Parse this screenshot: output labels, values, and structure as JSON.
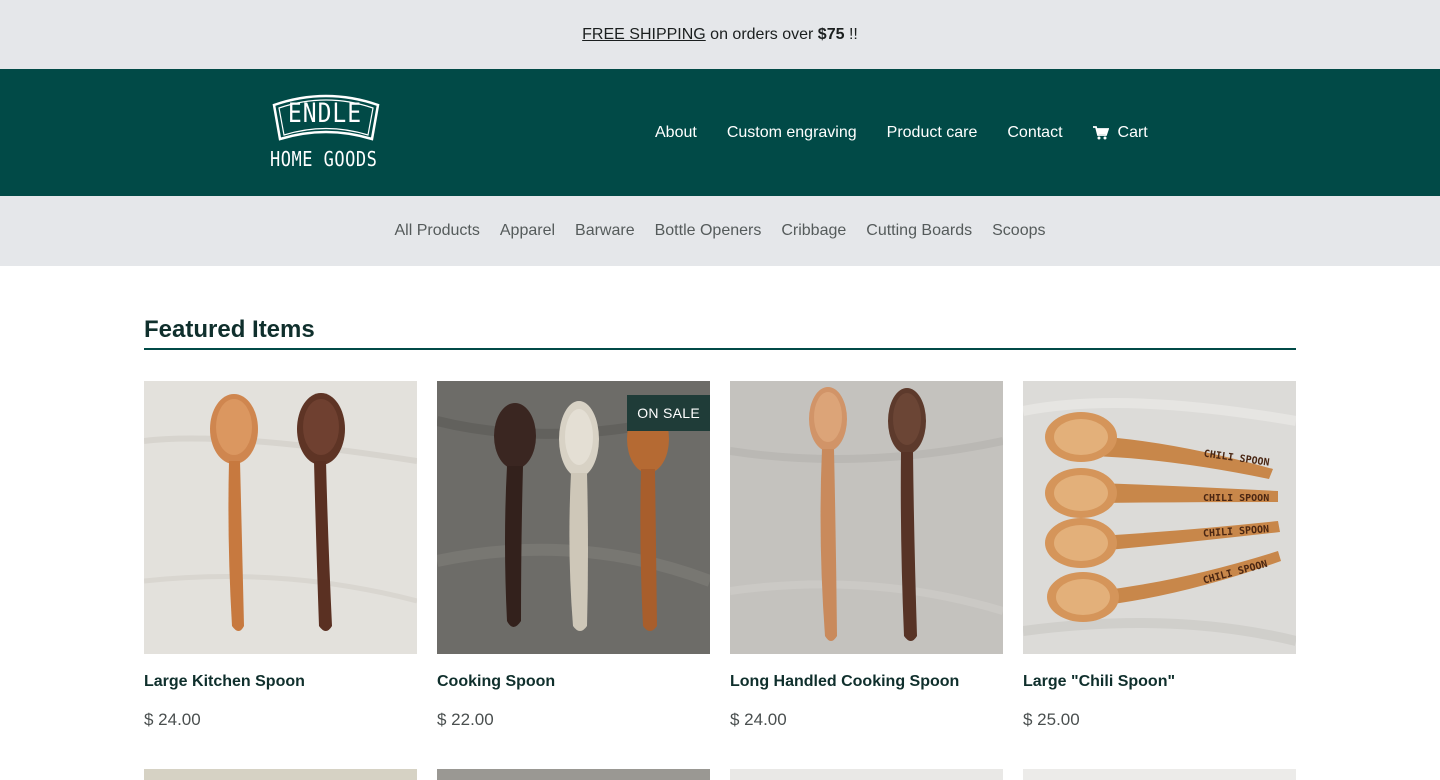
{
  "announcement": {
    "link_text": "FREE SHIPPING",
    "middle_text": " on orders over ",
    "amount": "$75",
    "suffix": " !!"
  },
  "brand": {
    "name": "ENDLE",
    "sub": "HOME GOODS"
  },
  "main_nav": {
    "items": [
      "About",
      "Custom engraving",
      "Product care",
      "Contact"
    ],
    "cart_label": "Cart",
    "cart_icon": "cart-icon"
  },
  "categories": [
    "All Products",
    "Apparel",
    "Barware",
    "Bottle Openers",
    "Cribbage",
    "Cutting Boards",
    "Scoops"
  ],
  "featured": {
    "title": "Featured Items",
    "products": [
      {
        "name": "Large Kitchen Spoon",
        "price": "$ 24.00",
        "badge": ""
      },
      {
        "name": "Cooking Spoon",
        "price": "$ 22.00",
        "badge": "ON SALE"
      },
      {
        "name": "Long Handled Cooking Spoon",
        "price": "$ 24.00",
        "badge": ""
      },
      {
        "name": "Large \"Chili Spoon\"",
        "price": "$ 25.00",
        "badge": ""
      }
    ],
    "engraving_text": "CHILI SPOON"
  },
  "colors": {
    "header_bg": "#014a47",
    "bar_bg": "#e5e7ea",
    "badge_bg": "#1f3c38"
  }
}
